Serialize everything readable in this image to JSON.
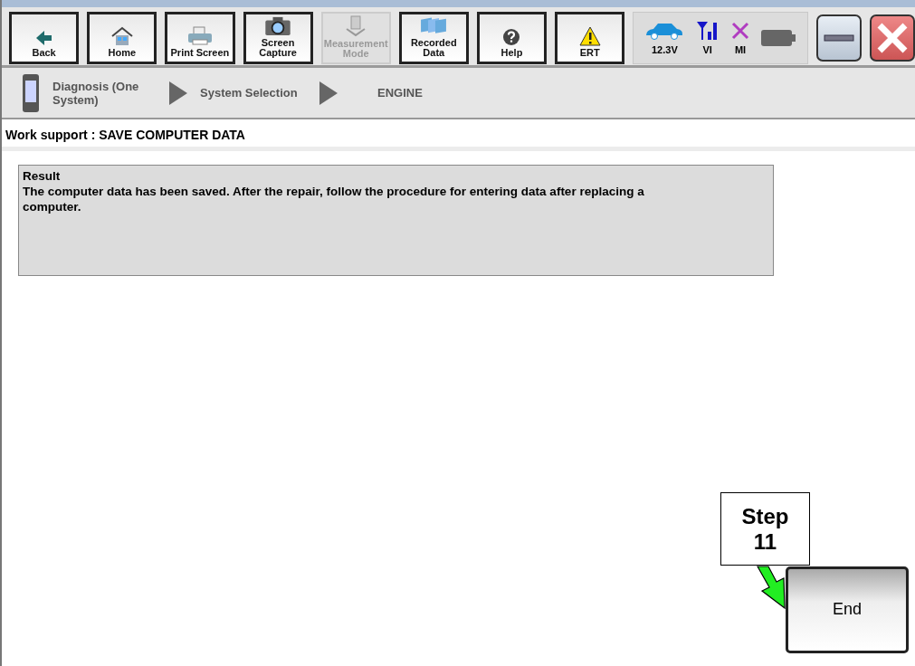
{
  "toolbar": [
    {
      "kind": "back",
      "label": "Back",
      "disabled": false
    },
    {
      "kind": "home",
      "label": "Home",
      "disabled": false
    },
    {
      "kind": "print",
      "label": "Print Screen",
      "disabled": false
    },
    {
      "kind": "camera",
      "label": "Screen Capture",
      "disabled": false
    },
    {
      "kind": "meter",
      "label": "Measurement Mode",
      "disabled": true
    },
    {
      "kind": "folders",
      "label": "Recorded Data",
      "disabled": false
    },
    {
      "kind": "help",
      "label": "Help",
      "disabled": false
    },
    {
      "kind": "warning",
      "label": "ERT",
      "disabled": false
    }
  ],
  "status": [
    {
      "kind": "car",
      "label": "12.3V"
    },
    {
      "kind": "signal",
      "label": "VI"
    },
    {
      "kind": "cross",
      "label": "MI"
    },
    {
      "kind": "battery"
    }
  ],
  "breadcrumb": [
    "Diagnosis (One System)",
    "System Selection",
    "ENGINE"
  ],
  "title": "Work support : SAVE COMPUTER DATA",
  "result": {
    "heading": "Result",
    "text": "The computer data has been saved. After the repair, follow the procedure for entering data after replacing a computer."
  },
  "callout": "Step 11",
  "end_button": "End"
}
